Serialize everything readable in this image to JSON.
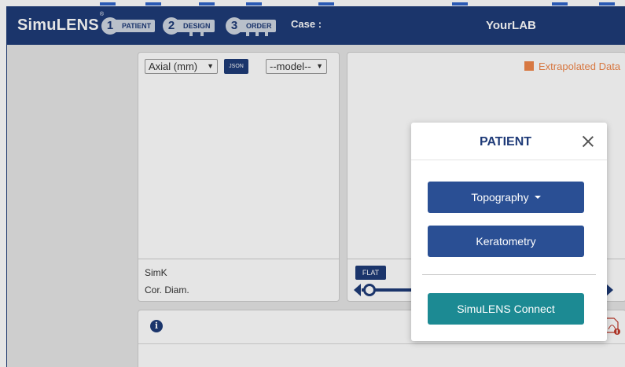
{
  "header": {
    "brand": "SimuLENS",
    "brand_mark": "®",
    "steps": [
      {
        "number": "1",
        "label": "PATIENT"
      },
      {
        "number": "2",
        "label": "DESIGN"
      },
      {
        "number": "3",
        "label": "ORDER"
      }
    ],
    "case_label": "Case :",
    "lab_name": "YourLAB"
  },
  "axial_panel": {
    "map_select": "Axial (mm)",
    "json_button": "JSON",
    "model_select": "--model--",
    "simk_label": "SimK",
    "cor_diam_label": "Cor. Diam."
  },
  "right_panel": {
    "extrapolated_label": "Extrapolated Data",
    "flat_button": "FLAT"
  },
  "bottom_panel": {
    "info_icon": "i"
  },
  "modal": {
    "title": "PATIENT",
    "topography_button": "Topography",
    "keratometry_button": "Keratometry",
    "connect_button": "SimuLENS Connect"
  },
  "colors": {
    "header": "#1f3b78",
    "primary_button": "#2a4f94",
    "connect_button": "#1c8a93",
    "extrapolated": "#f0864a"
  }
}
